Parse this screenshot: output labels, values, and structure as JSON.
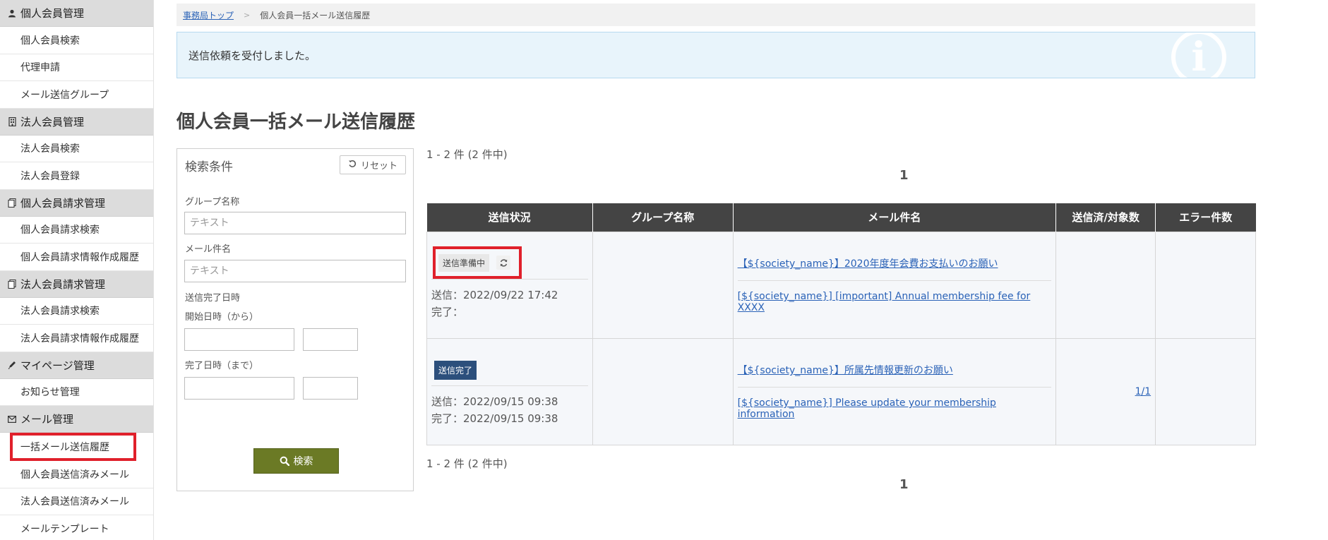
{
  "sidebar": {
    "sections": [
      {
        "icon": "person-icon",
        "title": "個人会員管理",
        "items": [
          "個人会員検索",
          "代理申請",
          "メール送信グループ"
        ]
      },
      {
        "icon": "building-icon",
        "title": "法人会員管理",
        "items": [
          "法人会員検索",
          "法人会員登録"
        ]
      },
      {
        "icon": "document-icon",
        "title": "個人会員請求管理",
        "items": [
          "個人会員請求検索",
          "個人会員請求情報作成履歴"
        ]
      },
      {
        "icon": "document-icon",
        "title": "法人会員請求管理",
        "items": [
          "法人会員請求検索",
          "法人会員請求情報作成履歴"
        ]
      },
      {
        "icon": "pencil-icon",
        "title": "マイページ管理",
        "items": [
          "お知らせ管理"
        ]
      },
      {
        "icon": "envelope-icon",
        "title": "メール管理",
        "items": [
          "一括メール送信履歴",
          "個人会員送信済みメール",
          "法人会員送信済みメール",
          "メールテンプレート"
        ]
      }
    ],
    "active_item": "一括メール送信履歴"
  },
  "breadcrumb": {
    "home": "事務局トップ",
    "separator": ">",
    "current": "個人会員一括メール送信履歴"
  },
  "alert": {
    "message": "送信依頼を受付しました。",
    "icon": "info-icon"
  },
  "page_title": "個人会員一括メール送信履歴",
  "search": {
    "title": "検索条件",
    "reset_label": "リセット",
    "group_label": "グループ名称",
    "group_placeholder": "テキスト",
    "subject_label": "メール件名",
    "subject_placeholder": "テキスト",
    "completed_label": "送信完了日時",
    "start_label": "開始日時（から）",
    "end_label": "完了日時（まで）",
    "search_label": "検索"
  },
  "results": {
    "count_text": "1 - 2 件 (2 件中)",
    "page": "1",
    "headers": [
      "送信状況",
      "グループ名称",
      "メール件名",
      "送信済/対象数",
      "エラー件数"
    ],
    "rows": [
      {
        "status": "送信準備中",
        "sent": "送信：2022/09/22 17:42",
        "done": "完了：",
        "group": "",
        "subject_ja": "【${society_name}】2020年度年会費お支払いのお願い",
        "subject_en": "[${society_name}] [important] Annual membership fee for XXXX",
        "sent_count": "",
        "errors": ""
      },
      {
        "status": "送信完了",
        "sent": "送信：2022/09/15 09:38",
        "done": "完了：2022/09/15 09:38",
        "group": "",
        "subject_ja": "【${society_name}】所属先情報更新のお願い",
        "subject_en": "[${society_name}] Please update your membership information",
        "sent_count": "1/1",
        "errors": ""
      }
    ]
  },
  "colors": {
    "sidebar_header_bg": "#dcdcdc",
    "table_header_bg": "#444444",
    "search_button_bg": "#6b7a25",
    "done_badge_bg": "#2c4f7c",
    "highlight_red": "#e0202b",
    "alert_bg": "#e8f4fb",
    "link": "#2a62b7"
  }
}
